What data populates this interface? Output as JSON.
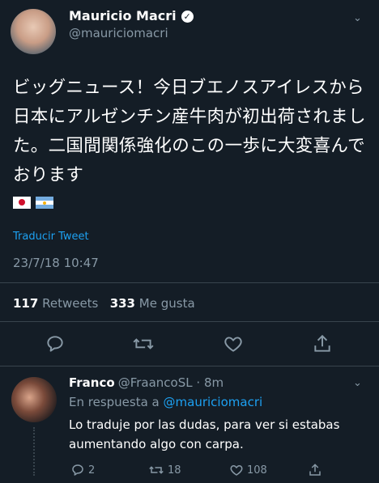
{
  "tweet": {
    "author_name": "Mauricio Macri",
    "handle": "@mauriciomacri",
    "text": "ビッグニュース！今日ブエノスアイレスから日本にアルゼンチン産牛肉が初出荷されました。二国間関係強化のこの一歩に大変喜んでおります",
    "flags": [
      "japan-flag",
      "argentina-flag"
    ],
    "translate_label": "Traducir Tweet",
    "timestamp": "23/7/18 10:47",
    "retweets_count": "117",
    "retweets_label": "Retweets",
    "likes_count": "333",
    "likes_label": "Me gusta"
  },
  "reply": {
    "author_name": "Franco",
    "handle": "@FraancoSL",
    "separator": "·",
    "time": "8m",
    "in_reply_prefix": "En respuesta a",
    "in_reply_mention": "@mauriciomacri",
    "text": "Lo traduje por las dudas, para ver si estabas aumentando algo con carpa.",
    "reply_count": "2",
    "retweet_count": "18",
    "like_count": "108"
  },
  "colors": {
    "background": "#141d26",
    "text_primary": "#ffffff",
    "text_secondary": "#8899a6",
    "accent_link": "#1da1f2",
    "divider": "#38444d"
  }
}
